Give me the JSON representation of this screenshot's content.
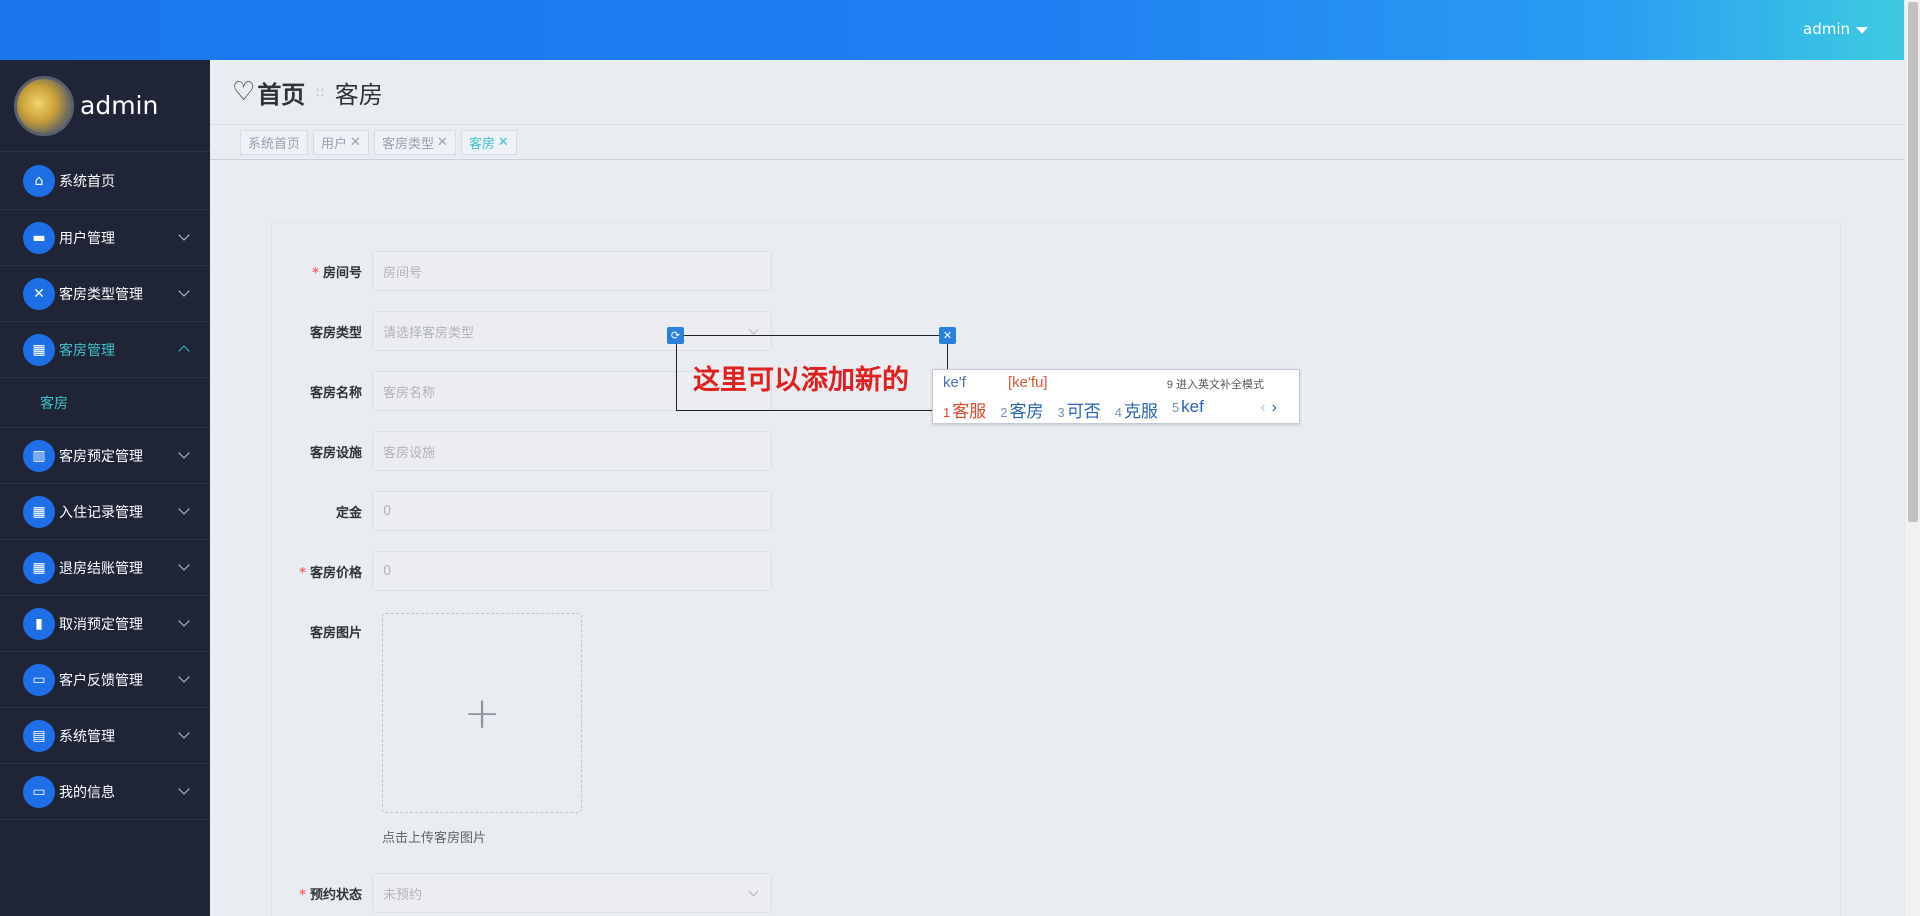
{
  "topbar": {
    "user": "admin"
  },
  "sidebar": {
    "profile_name": "admin",
    "items": [
      {
        "label": "系统首页",
        "icon": "home-icon",
        "glyph": "⌂",
        "expandable": false
      },
      {
        "label": "用户管理",
        "icon": "briefcase-icon",
        "glyph": "▬",
        "expandable": true
      },
      {
        "label": "客房类型管理",
        "icon": "clipboard-icon",
        "glyph": "✕",
        "expandable": true
      },
      {
        "label": "客房管理",
        "icon": "grid-icon",
        "glyph": "▦",
        "expandable": true,
        "active": true
      },
      {
        "label": "客房预定管理",
        "icon": "book-icon",
        "glyph": "▥",
        "expandable": true
      },
      {
        "label": "入住记录管理",
        "icon": "grid-icon",
        "glyph": "▦",
        "expandable": true
      },
      {
        "label": "退房结账管理",
        "icon": "grid-icon",
        "glyph": "▦",
        "expandable": true
      },
      {
        "label": "取消预定管理",
        "icon": "bar-chart-icon",
        "glyph": "▮",
        "expandable": true
      },
      {
        "label": "客户反馈管理",
        "icon": "monitor-icon",
        "glyph": "▭",
        "expandable": true
      },
      {
        "label": "系统管理",
        "icon": "document-icon",
        "glyph": "▤",
        "expandable": true
      },
      {
        "label": "我的信息",
        "icon": "card-icon",
        "glyph": "▭",
        "expandable": true
      }
    ],
    "submenu_label": "客房"
  },
  "header": {
    "crumb_home": "首页",
    "crumb_sep": "::",
    "crumb_current": "客房"
  },
  "tags": [
    {
      "label": "系统首页",
      "closable": false
    },
    {
      "label": "用户",
      "closable": true
    },
    {
      "label": "客房类型",
      "closable": true
    },
    {
      "label": "客房",
      "closable": true,
      "active": true
    }
  ],
  "form": {
    "room_no": {
      "label": "房间号",
      "required": true,
      "placeholder": "房间号"
    },
    "room_type": {
      "label": "客房类型",
      "required": false,
      "placeholder": "请选择客房类型"
    },
    "room_name": {
      "label": "客房名称",
      "required": false,
      "placeholder": "客房名称"
    },
    "facilities": {
      "label": "客房设施",
      "required": false,
      "placeholder": "客房设施"
    },
    "deposit": {
      "label": "定金",
      "required": false,
      "value": "0"
    },
    "price": {
      "label": "客房价格",
      "required": true,
      "value": "0"
    },
    "image": {
      "label": "客房图片",
      "hint": "点击上传客房图片",
      "plus": "+"
    },
    "reserve_status": {
      "label": "预约状态",
      "required": true,
      "value": "未预约"
    }
  },
  "annotation": {
    "text": "这里可以添加新的"
  },
  "ime": {
    "input": "ke'f",
    "pinyin": "[ke'fu]",
    "hint": "9 进入英文补全模式",
    "candidates": [
      {
        "n": "1",
        "text": "客服"
      },
      {
        "n": "2",
        "text": "客房"
      },
      {
        "n": "3",
        "text": "可否"
      },
      {
        "n": "4",
        "text": "克服"
      },
      {
        "n": "5",
        "text": "kef"
      }
    ]
  }
}
